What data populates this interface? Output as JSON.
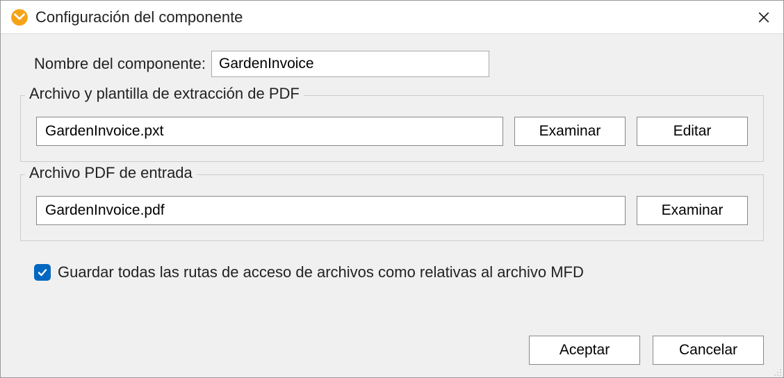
{
  "window": {
    "title": "Configuración del componente"
  },
  "name": {
    "label": "Nombre del componente:",
    "value": "GardenInvoice"
  },
  "section_template": {
    "legend": "Archivo y plantilla de extracción de PDF",
    "file_value": "GardenInvoice.pxt",
    "browse_label": "Examinar",
    "edit_label": "Editar"
  },
  "section_pdf": {
    "legend": "Archivo PDF de entrada",
    "file_value": "GardenInvoice.pdf",
    "browse_label": "Examinar"
  },
  "checkbox": {
    "checked": true,
    "label": "Guardar todas las rutas de acceso de archivos como relativas al archivo MFD"
  },
  "footer": {
    "ok_label": "Aceptar",
    "cancel_label": "Cancelar"
  }
}
